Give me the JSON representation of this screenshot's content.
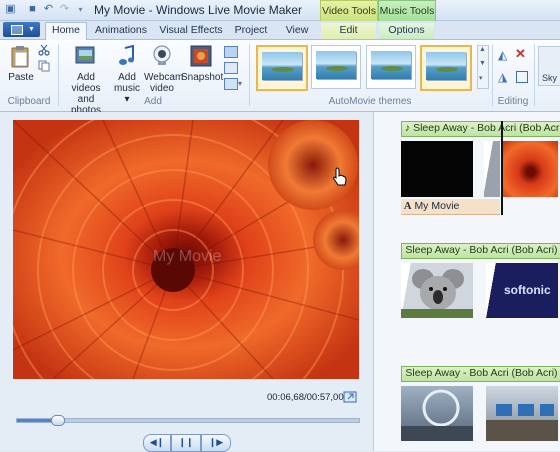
{
  "window": {
    "title": "My Movie - Windows Live Movie Maker"
  },
  "context_tabs": {
    "video_tools": "Video Tools",
    "music_tools": "Music Tools"
  },
  "tabs": [
    "Home",
    "Animations",
    "Visual Effects",
    "Project",
    "View",
    "Edit",
    "Options"
  ],
  "ribbon": {
    "clipboard": {
      "paste": "Paste",
      "group": "Clipboard"
    },
    "add": {
      "add_videos_line1": "Add videos",
      "add_videos_line2": "and photos",
      "add_music": "Add",
      "add_music_line2": "music ▾",
      "webcam_line1": "Webcam",
      "webcam_line2": "video",
      "snapshot": "Snapshot",
      "group": "Add"
    },
    "automovie": {
      "group": "AutoMovie themes"
    },
    "editing": {
      "group": "Editing"
    },
    "sky_label": "Sky"
  },
  "preview": {
    "timecode": "00:06,68/00:57,00",
    "watermark": "My Movie",
    "progress": 0.12
  },
  "storyboard": {
    "clips": [
      {
        "music": "Sleep Away - Bob Acri (Bob Acri)",
        "caption": "My Movie"
      },
      {
        "music": "Sleep Away - Bob Acri (Bob Acri)",
        "caption": "softonic"
      },
      {
        "music": "Sleep Away - Bob Acri (Bob Acri)",
        "caption": ""
      }
    ]
  },
  "icons": {
    "paste": "clipboard-icon",
    "cut": "scissors-icon",
    "copy": "copy-icon",
    "add_videos": "film-photo-icon",
    "add_music": "music-note-icon",
    "webcam": "webcam-icon",
    "snapshot": "snapshot-icon",
    "prev_frame": "previous-frame-icon",
    "play_pause": "pause-icon",
    "next_frame": "next-frame-icon"
  },
  "colors": {
    "accent": "#1d4f97",
    "music_label": "#bfe3a3",
    "video_tools": "#c9e07c",
    "music_tools": "#9fdc94"
  }
}
